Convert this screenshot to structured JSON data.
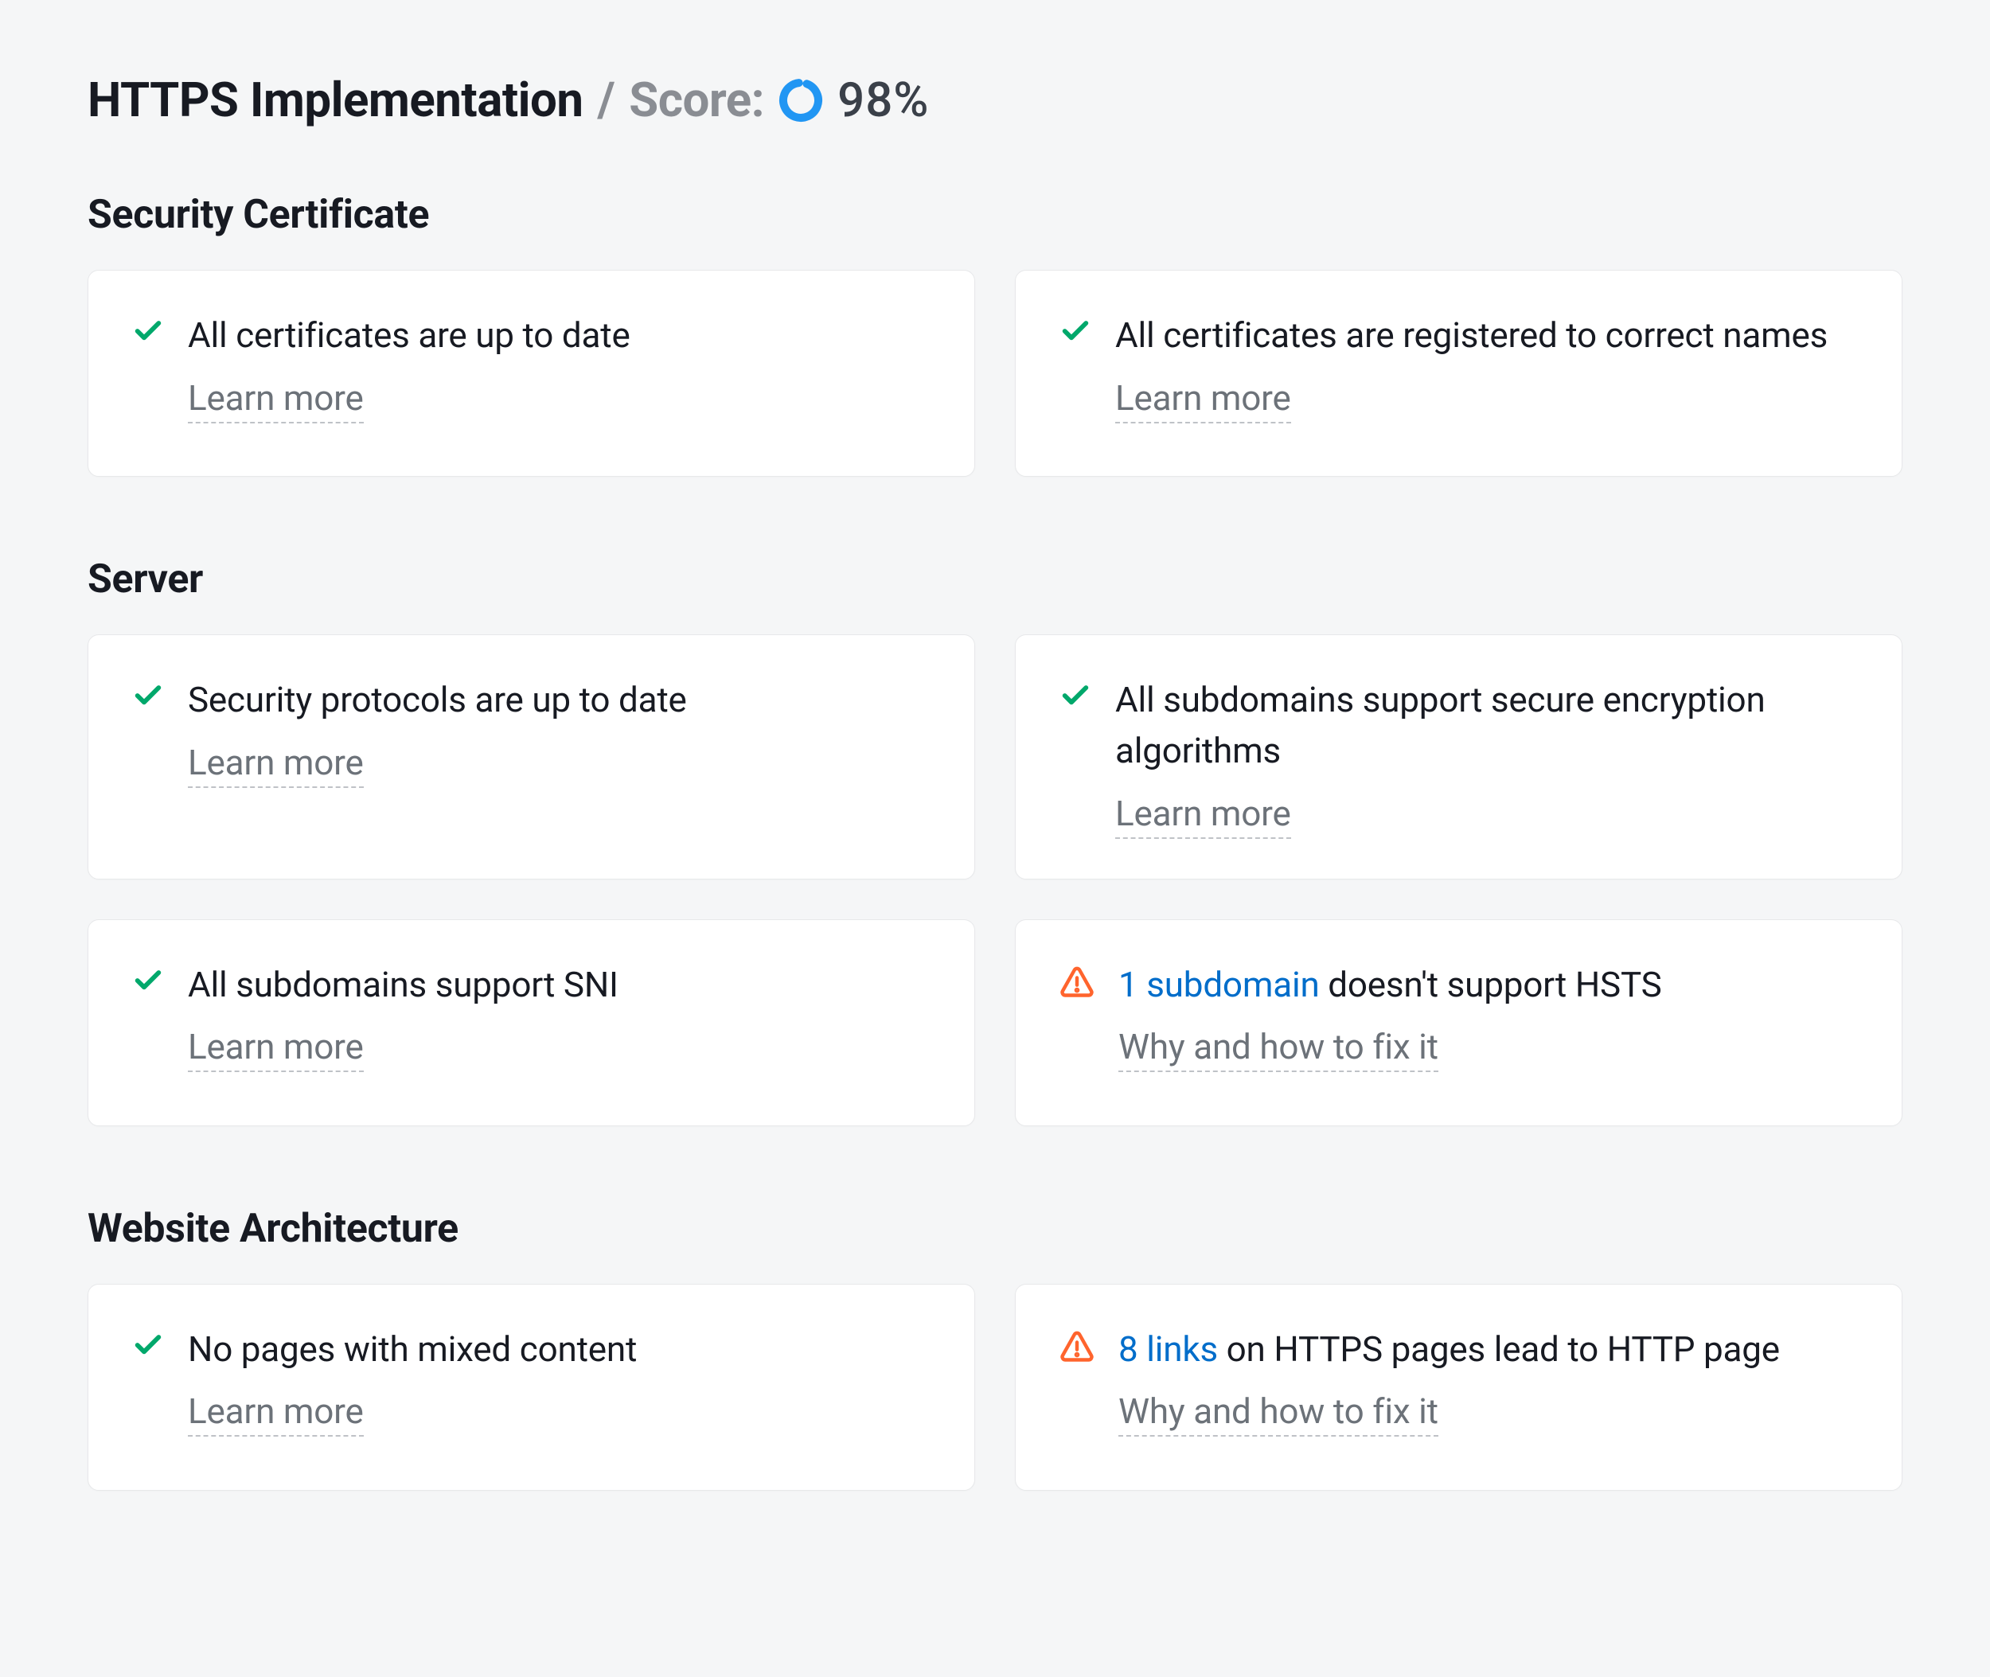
{
  "header": {
    "title": "HTTPS Implementation",
    "divider": "/",
    "score_label": "Score:",
    "score_value": "98%",
    "score_pct": 98
  },
  "link_labels": {
    "learn": "Learn more",
    "fix": "Why and how to fix it"
  },
  "sections": [
    {
      "title": "Security Certificate",
      "rows": [
        [
          {
            "status": "ok",
            "text": "All certificates are up to date",
            "link": "learn"
          },
          {
            "status": "ok",
            "text": "All certificates are registered to correct names",
            "link": "learn"
          }
        ]
      ]
    },
    {
      "title": "Server",
      "rows": [
        [
          {
            "status": "ok",
            "text": "Security protocols are up to date",
            "link": "learn"
          },
          {
            "status": "ok",
            "text": "All subdomains support secure encryption algorithms",
            "link": "learn"
          }
        ],
        [
          {
            "status": "ok",
            "text": "All subdomains support SNI",
            "link": "learn"
          },
          {
            "status": "warn",
            "count_text": "1 subdomain",
            "rest_text": " doesn't support HSTS",
            "link": "fix"
          }
        ]
      ]
    },
    {
      "title": "Website Architecture",
      "rows": [
        [
          {
            "status": "ok",
            "text": "No pages with mixed content",
            "link": "learn"
          },
          {
            "status": "warn",
            "count_text": "8 links",
            "rest_text": " on HTTPS pages lead to HTTP page",
            "link": "fix"
          }
        ]
      ]
    }
  ]
}
